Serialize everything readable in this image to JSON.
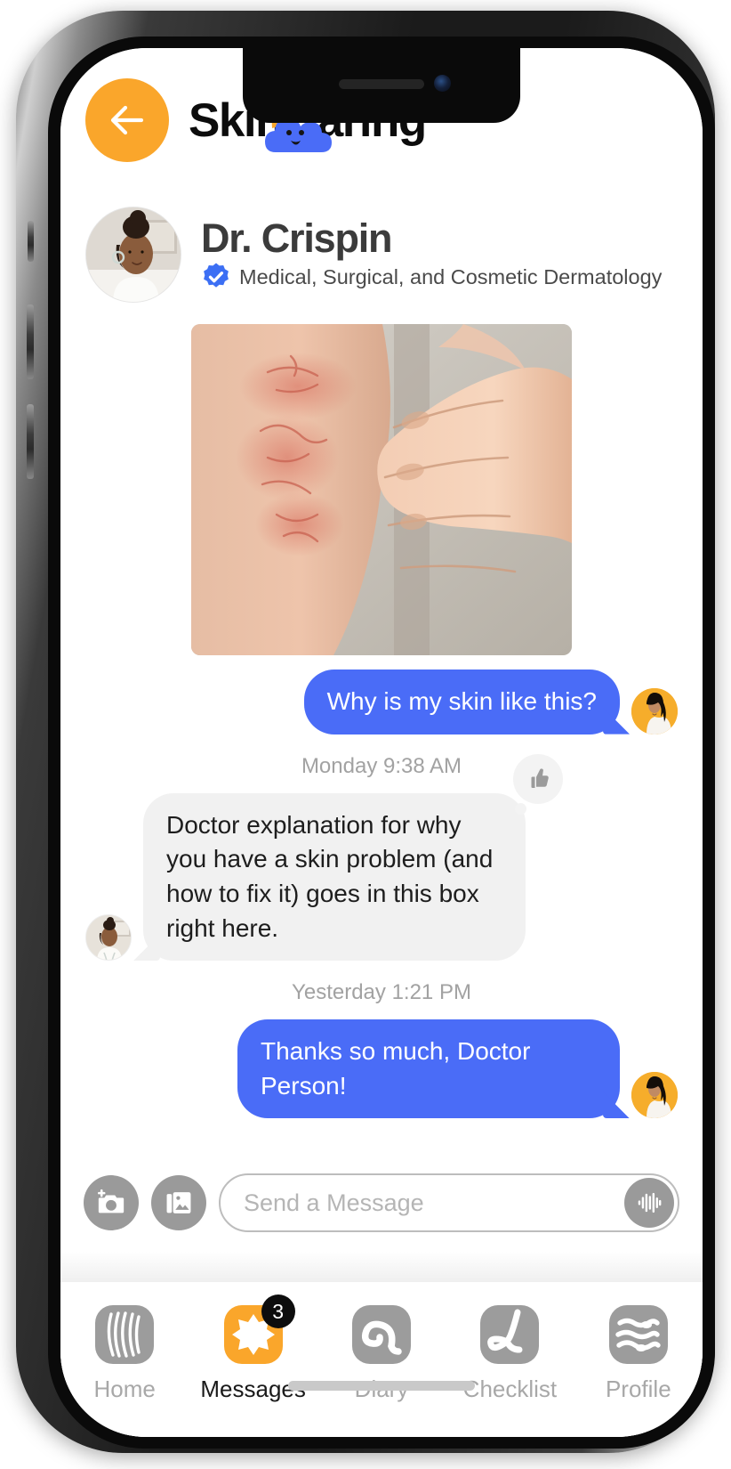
{
  "app": {
    "brand_part1": "Skin",
    "brand_part2": "Caring",
    "back_icon": "arrow-left-icon",
    "accent_orange": "#FAA62B",
    "accent_blue": "#4A6CF7",
    "bubble_gray": "#f1f1f1"
  },
  "doctor": {
    "name": "Dr. Crispin",
    "specialty": "Medical, Surgical, and Cosmetic Dermatology",
    "verified_icon": "verified-badge-icon",
    "avatar_alt": "doctor-avatar"
  },
  "messages": [
    {
      "kind": "image",
      "name": "skin-photo-message",
      "alt": "photo of arm with red rash being scratched by a hand"
    },
    {
      "kind": "outgoing",
      "text": "Why is my skin like this?",
      "avatar": "user-avatar"
    },
    {
      "kind": "timestamp",
      "text": "Monday 9:38 AM"
    },
    {
      "kind": "incoming",
      "text": "Doctor explanation for why you have a skin problem (and how to fix it) goes in this box right here.",
      "avatar": "doctor-avatar",
      "reaction": "thumbs-up-icon"
    },
    {
      "kind": "timestamp",
      "text": "Yesterday 1:21 PM"
    },
    {
      "kind": "outgoing",
      "text": "Thanks so much, Doctor Person!",
      "avatar": "user-avatar"
    }
  ],
  "composer": {
    "camera_icon": "camera-add-icon",
    "gallery_icon": "photo-library-icon",
    "mic_icon": "voice-waveform-icon",
    "placeholder": "Send a Message",
    "value": ""
  },
  "tabbar": {
    "items": [
      {
        "label": "Home",
        "icon": "skin-lines-icon",
        "active": false,
        "badge": ""
      },
      {
        "label": "Messages",
        "icon": "star-burst-icon",
        "active": true,
        "badge": "3"
      },
      {
        "label": "Diary",
        "icon": "swirl-icon",
        "active": false,
        "badge": ""
      },
      {
        "label": "Checklist",
        "icon": "checkmark-icon",
        "active": false,
        "badge": ""
      },
      {
        "label": "Profile",
        "icon": "wave-face-icon",
        "active": false,
        "badge": ""
      }
    ]
  }
}
